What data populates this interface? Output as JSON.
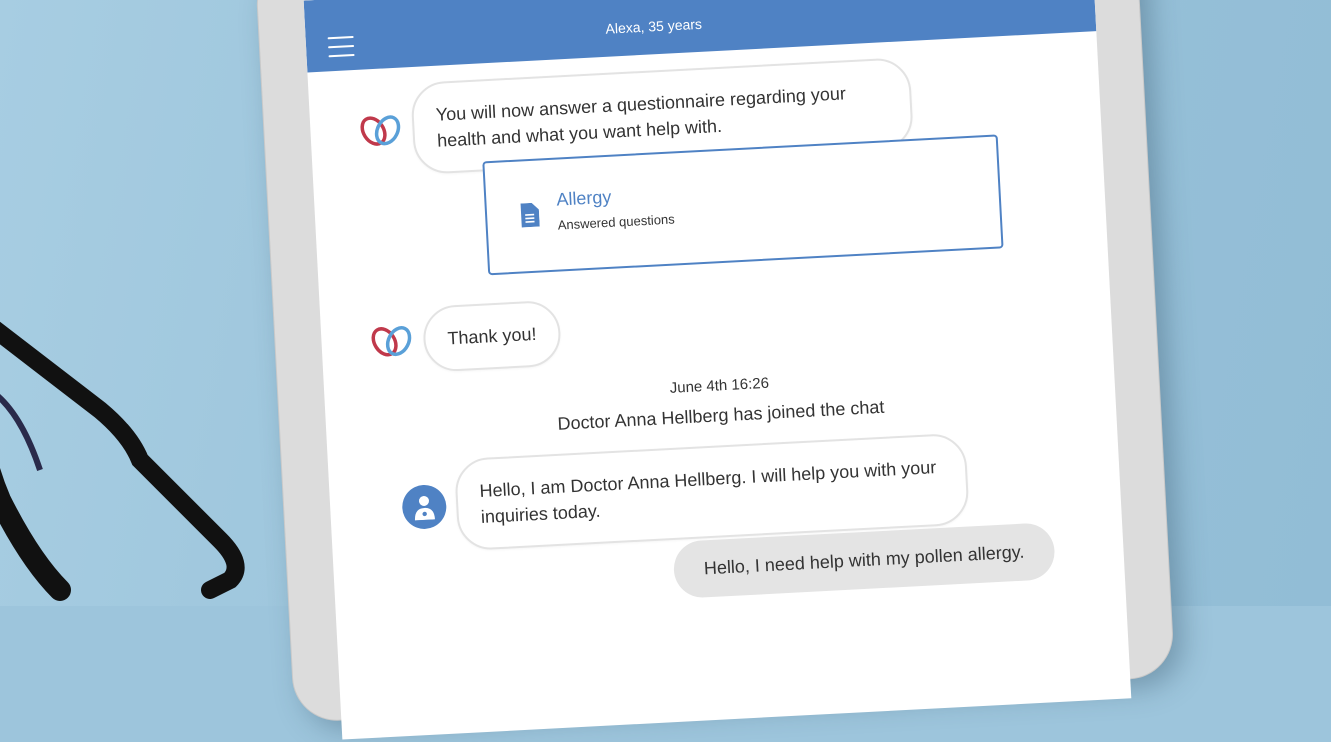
{
  "header": {
    "menu_icon": "hamburger-menu-icon",
    "patient_label": "Alexa, 35 years",
    "bar_color": "#4f82c4"
  },
  "chat": {
    "bot_intro": "You will now answer a questionnaire regarding your health and what you want help with.",
    "questionnaire_card": {
      "icon": "document-icon",
      "title": "Allergy",
      "subtitle": "Answered questions"
    },
    "bot_thanks": "Thank you!",
    "timestamp": "June 4th 16:26",
    "join_notice": "Doctor Anna Hellberg has joined the chat",
    "doctor_message": "Hello, I am Doctor Anna Hellberg. I will help you with your inquiries today.",
    "user_message": "Hello, I need help with my pollen allergy."
  },
  "colors": {
    "accent": "#4f82c4",
    "logo_red": "#c0394b",
    "logo_blue": "#5aa0d8",
    "user_bubble": "#e4e4e4"
  }
}
